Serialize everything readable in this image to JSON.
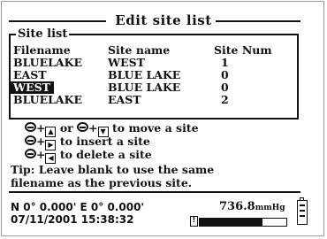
{
  "title": "Edit site list",
  "site_list": {
    "label": "Site list",
    "columns": [
      "Filename",
      "Site name",
      "Site Num"
    ],
    "rows": [
      {
        "filename": "BLUELAKE",
        "site_name": "WEST",
        "site_num": "1",
        "selected": false
      },
      {
        "filename": "EAST",
        "site_name": "BLUE LAKE",
        "site_num": "0",
        "selected": false
      },
      {
        "filename": "WEST",
        "site_name": "BLUE LAKE",
        "site_num": "0",
        "selected": true
      },
      {
        "filename": "BLUELAKE",
        "site_name": "EAST",
        "site_num": "2",
        "selected": false
      }
    ]
  },
  "instructions": {
    "move": {
      "sep": "or",
      "text": "to move a site"
    },
    "insert": {
      "text": "to insert a site"
    },
    "delete": {
      "text": "to delete a site"
    }
  },
  "tip": {
    "line1": "Tip: Leave blank to use the same",
    "line2": "filename as the previous site."
  },
  "status": {
    "coordinates": "N 0° 0.000' E 0° 0.000'",
    "datetime": "07/11/2001 15:38:32",
    "pressure_value": "736.8",
    "pressure_unit": "mmHg",
    "memory_used_fraction": 0.72
  },
  "icons": {
    "combo_key": "circle-plus-icon",
    "up": "arrow-up-icon",
    "down": "arrow-down-icon",
    "right": "arrow-right-icon",
    "left": "arrow-left-icon",
    "battery": "battery-icon"
  }
}
